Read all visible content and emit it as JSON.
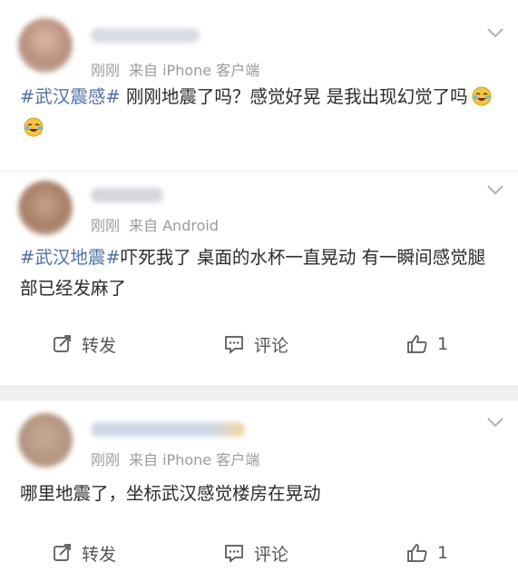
{
  "posts": [
    {
      "time": "刚刚",
      "source": "来自 iPhone 客户端",
      "hashtag": "#武汉震感#",
      "text": " 刚刚地震了吗？感觉好晃 是我出现幻觉了吗",
      "emoji_count": 2,
      "colors": {
        "avatar": "#c9a08a",
        "name": "#d8dbe2"
      }
    },
    {
      "time": "刚刚",
      "source": "来自 Android",
      "hashtag": "#武汉地震#",
      "text": "吓死我了 桌面的水杯一直晃动 有一瞬间感觉腿部已经发麻了",
      "share": "转发",
      "comment": "评论",
      "like": "1",
      "colors": {
        "avatar": "#b79b86",
        "name": "#d4d6dc"
      }
    },
    {
      "time": "刚刚",
      "source": "来自 iPhone 客户端",
      "text": "哪里地震了，坐标武汉感觉楼房在晃动",
      "share": "转发",
      "comment": "评论",
      "like": "1",
      "colors": {
        "avatar": "#bfa79a",
        "name": "#cfd7e4"
      }
    }
  ],
  "icons": {
    "chevron": "chevron-down-icon",
    "share": "share-icon",
    "comment": "comment-icon",
    "like": "thumbs-up-icon",
    "emoji": "laughing-crying-emoji"
  },
  "theme": {
    "hashtag": "#4f6fa6",
    "meta": "#9b9b9b"
  }
}
